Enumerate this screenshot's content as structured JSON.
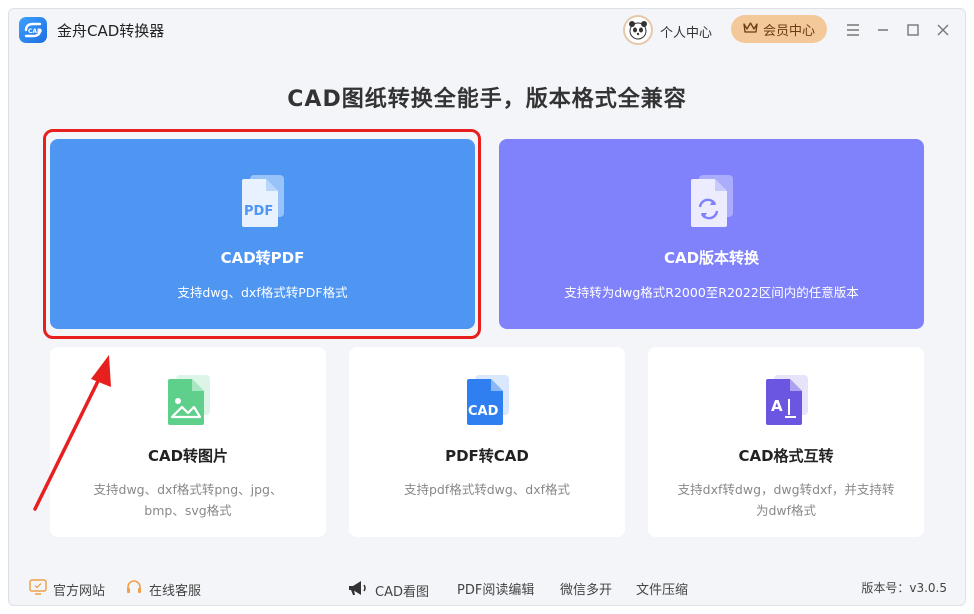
{
  "app": {
    "title": "金舟CAD转换器"
  },
  "header": {
    "personal_label": "个人中心",
    "vip_label": "会员中心"
  },
  "headline": "CAD图纸转换全能手，版本格式全兼容",
  "feature_cards": [
    {
      "title": "CAD转PDF",
      "desc": "支持dwg、dxf格式转PDF格式",
      "icon": "pdf-file-icon",
      "color": "#4f96f3"
    },
    {
      "title": "CAD版本转换",
      "desc": "支持转为dwg格式R2000至R2022区间内的任意版本",
      "icon": "version-convert-icon",
      "color": "#7f82fb"
    }
  ],
  "tool_cards": [
    {
      "title": "CAD转图片",
      "desc": "支持dwg、dxf格式转png、jpg、bmp、svg格式",
      "icon": "image-file-icon"
    },
    {
      "title": "PDF转CAD",
      "desc": "支持pdf格式转dwg、dxf格式",
      "icon": "cad-file-icon"
    },
    {
      "title": "CAD格式互转",
      "desc": "支持dxf转dwg，dwg转dxf，并支持转为dwf格式",
      "icon": "text-format-icon"
    }
  ],
  "footer": {
    "website": "官方网站",
    "support": "在线客服",
    "cad_viewer": "CAD看图",
    "pdf_editor": "PDF阅读编辑",
    "wechat": "微信多开",
    "compress": "文件压缩",
    "version": "版本号：v3.0.5"
  }
}
